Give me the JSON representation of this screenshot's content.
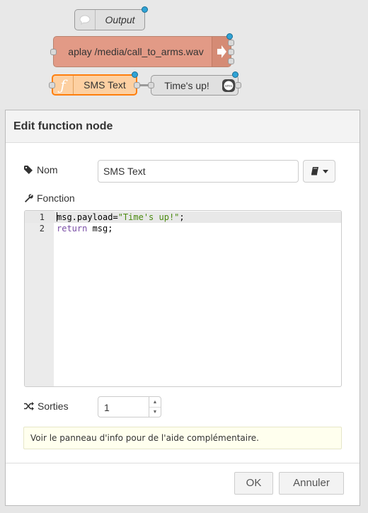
{
  "canvas": {
    "nodes": {
      "output": {
        "label": "Output"
      },
      "aplay": {
        "label": "aplay /media/call_to_arms.wav"
      },
      "function": {
        "label": "SMS Text",
        "icon": "function-icon"
      },
      "sms": {
        "label": "Time's up!",
        "icon_text": "sms"
      }
    }
  },
  "dialog": {
    "title": "Edit function node",
    "name": {
      "label": "Nom",
      "value": "SMS Text"
    },
    "function": {
      "label": "Fonction",
      "lines": [
        {
          "number": "1",
          "text": "msg.payload=\"Time's up!\";"
        },
        {
          "number": "2",
          "text": "return msg;"
        }
      ]
    },
    "outputs": {
      "label": "Sorties",
      "value": "1"
    },
    "tip": "Voir le panneau d'info pour de l'aide complémentaire.",
    "buttons": {
      "ok": "OK",
      "cancel": "Annuler"
    }
  },
  "colors": {
    "function_node": "#fdd0a2",
    "function_border": "#ff7f0e",
    "exec_node": "#e29a86",
    "changed_dot": "#2fa3d6",
    "string_token": "#4a8a0f",
    "keyword_token": "#7a4ea6"
  }
}
